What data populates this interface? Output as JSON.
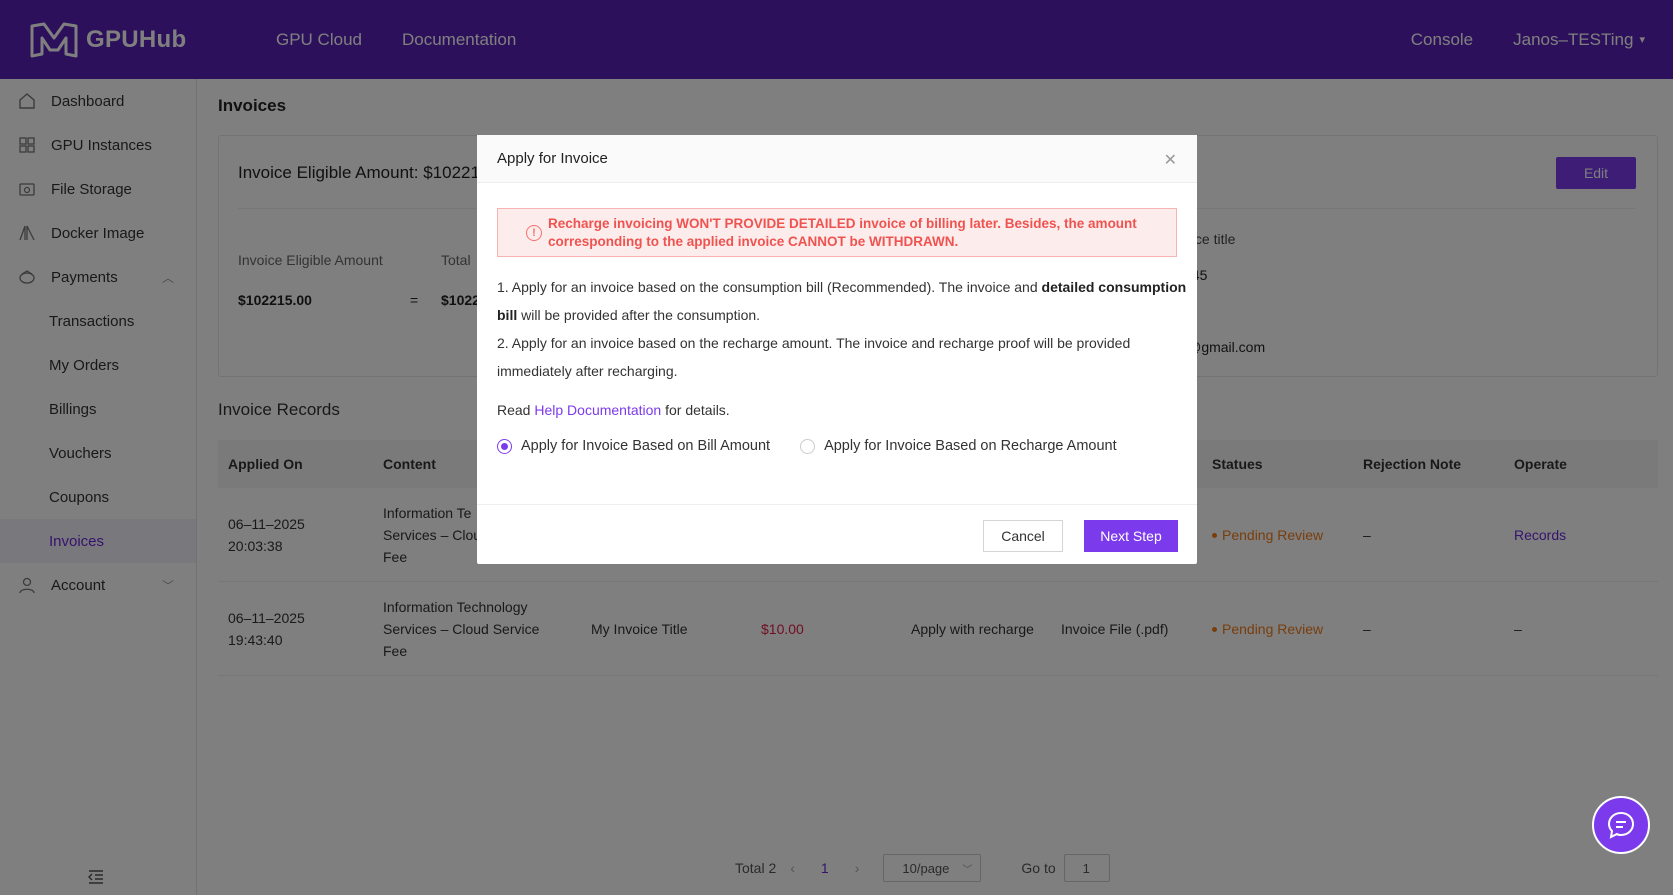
{
  "header": {
    "brand": "GPUHub",
    "nav": [
      "GPU Cloud",
      "Documentation"
    ],
    "console": "Console",
    "user": "Janos–TESTing"
  },
  "sidebar": {
    "items": [
      {
        "label": "Dashboard",
        "icon": "home-icon"
      },
      {
        "label": "GPU Instances",
        "icon": "grid-icon"
      },
      {
        "label": "File Storage",
        "icon": "folder-icon"
      },
      {
        "label": "Docker Image",
        "icon": "docker-icon"
      },
      {
        "label": "Payments",
        "icon": "wallet-icon"
      }
    ],
    "payments_sub": [
      "Transactions",
      "My Orders",
      "Billings",
      "Vouchers",
      "Coupons",
      "Invoices"
    ],
    "account": "Account"
  },
  "main": {
    "title": "Invoices",
    "eligible_heading": "Invoice Eligible Amount: $10221",
    "edit_label": "Edit",
    "eligible_label": "Invoice Eligible Amount",
    "total_label": "Total",
    "eligible_value": "$102215.00",
    "equals": "=",
    "total_value": "$1022",
    "right_title_label": "oice title",
    "right_value_1": "345",
    "right_value_2": "l@gmail.com",
    "records_title": "Invoice Records",
    "columns": [
      "Applied On",
      "Content",
      "",
      "",
      "",
      "",
      "Statues",
      "Rejection Note",
      "Operate"
    ],
    "rows": [
      {
        "date": "06–11–2025",
        "time": "20:03:38",
        "content_1": "Information Te",
        "content_2": "Services – Clou",
        "content_3": "Fee",
        "title": "",
        "amount": "",
        "type": "",
        "file": "",
        "status": "Pending Review",
        "note": "–",
        "operate": "Records"
      },
      {
        "date": "06–11–2025",
        "time": "19:43:40",
        "content_1": "Information Technology",
        "content_2": "Services – Cloud Service",
        "content_3": "Fee",
        "title": "My Invoice Title",
        "amount": "$10.00",
        "type": "Apply with recharge",
        "file": "Invoice File (.pdf)",
        "status": "Pending Review",
        "note": "–",
        "operate": "–"
      }
    ],
    "pager": {
      "total": "Total 2",
      "page": "1",
      "size": "10/page",
      "goto": "Go to",
      "goto_value": "1"
    }
  },
  "modal": {
    "title": "Apply for Invoice",
    "alert": "Recharge invoicing WON'T PROVIDE DETAILED invoice of billing later. Besides, the amount corresponding to the applied invoice CANNOT be WITHDRAWN.",
    "line1_a": "1. Apply for an invoice based on the consumption bill (Recommended). The invoice and ",
    "line1_b": "detailed consumption bill",
    "line1_c": " will be provided after the consumption.",
    "line2": "2. Apply for an invoice based on the recharge amount. The invoice and recharge proof will be provided immediately after recharging.",
    "read_prefix": "Read ",
    "read_link": "Help Documentation",
    "read_suffix": " for details.",
    "option_bill": "Apply for Invoice Based on Bill Amount",
    "option_recharge": "Apply for Invoice Based on Recharge Amount",
    "cancel": "Cancel",
    "next": "Next Step"
  }
}
